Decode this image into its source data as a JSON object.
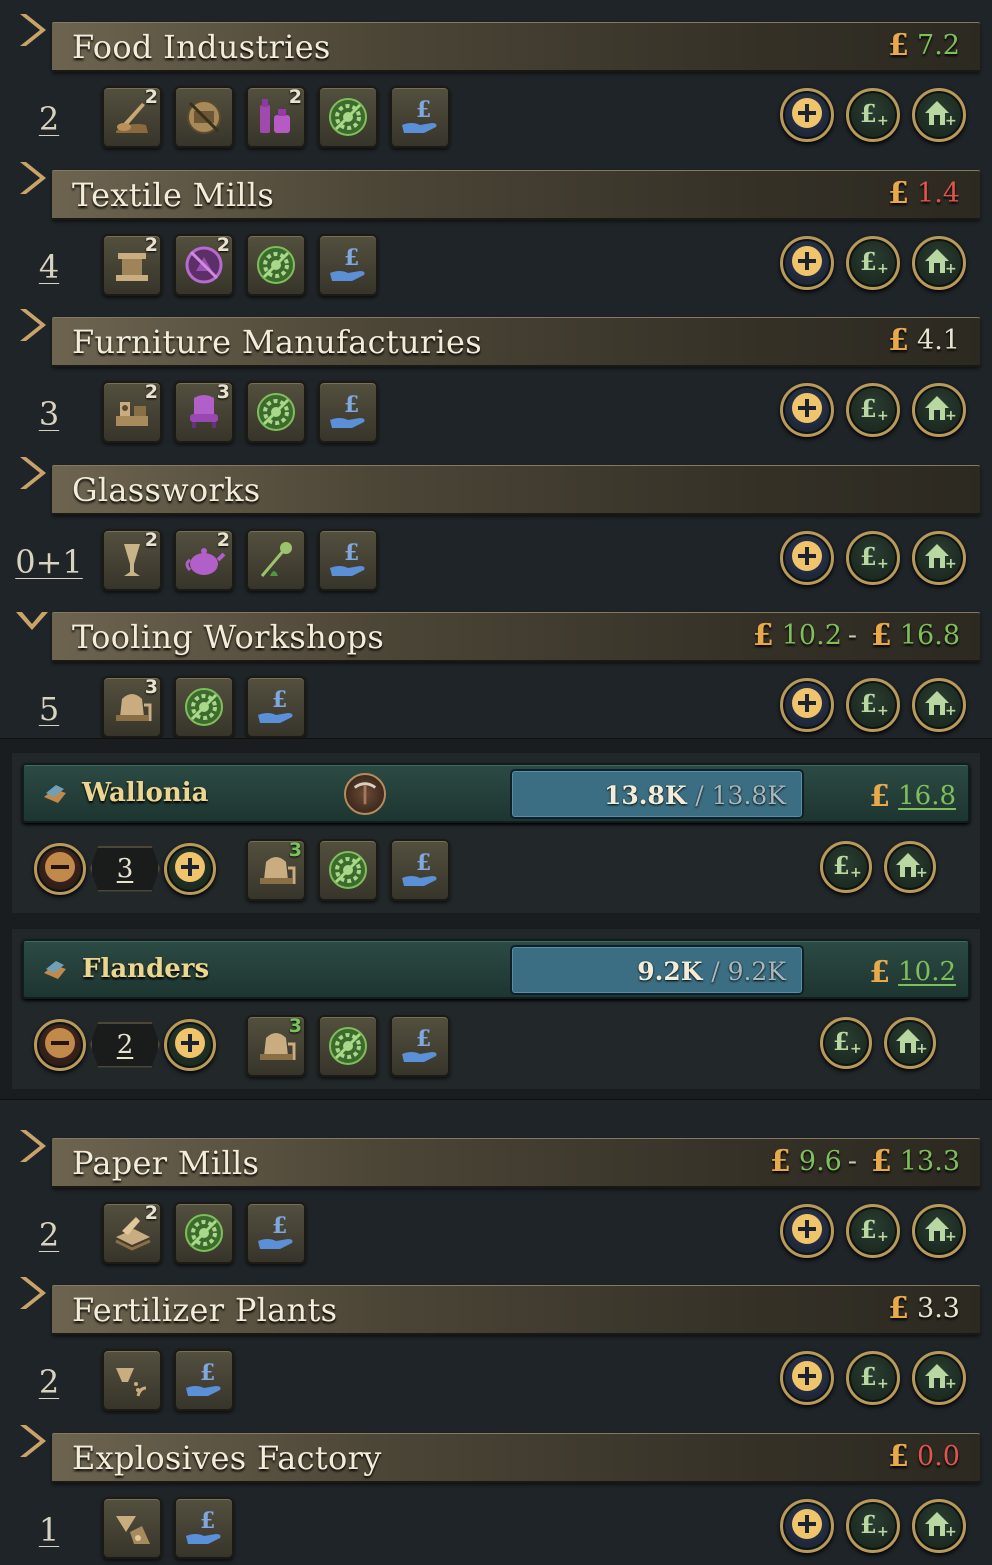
{
  "groups": [
    {
      "id": "food",
      "title": "Food Industries",
      "count": "2",
      "expanded": false,
      "money": [
        {
          "value": "7.2",
          "tone": "pos"
        }
      ],
      "tiles": [
        {
          "icon": "grain-scoop-icon",
          "badge": "2"
        },
        {
          "icon": "canned-goods-icon",
          "badge": ""
        },
        {
          "icon": "liquor-bottles-icon",
          "badge": "2"
        },
        {
          "icon": "production-method-gear-icon",
          "badge": ""
        },
        {
          "icon": "ownership-hand-pound-icon",
          "badge": ""
        }
      ]
    },
    {
      "id": "textile",
      "title": "Textile Mills",
      "count": "4",
      "expanded": false,
      "money": [
        {
          "value": "1.4",
          "tone": "neg"
        }
      ],
      "tiles": [
        {
          "icon": "loom-icon",
          "badge": "2"
        },
        {
          "icon": "no-luxury-clothes-icon",
          "badge": "2"
        },
        {
          "icon": "production-method-gear-icon",
          "badge": ""
        },
        {
          "icon": "ownership-hand-pound-icon",
          "badge": ""
        }
      ]
    },
    {
      "id": "furniture",
      "title": "Furniture Manufacturies",
      "count": "3",
      "expanded": false,
      "money": [
        {
          "value": "4.1",
          "tone": "neu"
        }
      ],
      "tiles": [
        {
          "icon": "lathe-icon",
          "badge": "2"
        },
        {
          "icon": "luxury-armchair-icon",
          "badge": "3"
        },
        {
          "icon": "production-method-gear-icon",
          "badge": ""
        },
        {
          "icon": "ownership-hand-pound-icon",
          "badge": ""
        }
      ]
    },
    {
      "id": "glass",
      "title": "Glassworks",
      "count": "0+1",
      "expanded": false,
      "money": [],
      "tiles": [
        {
          "icon": "glass-vase-icon",
          "badge": "2"
        },
        {
          "icon": "porcelain-teapot-icon",
          "badge": "2"
        },
        {
          "icon": "glassblowing-icon",
          "badge": ""
        },
        {
          "icon": "ownership-hand-pound-icon",
          "badge": ""
        }
      ]
    },
    {
      "id": "tooling",
      "title": "Tooling Workshops",
      "count": "5",
      "expanded": true,
      "money": [
        {
          "value": "10.2",
          "tone": "pos"
        },
        {
          "value": "16.8",
          "tone": "pos"
        }
      ],
      "tiles": [
        {
          "icon": "crucible-steel-icon",
          "badge": "3"
        },
        {
          "icon": "production-method-gear-icon",
          "badge": ""
        },
        {
          "icon": "ownership-hand-pound-icon",
          "badge": ""
        }
      ]
    },
    {
      "id": "paper",
      "title": "Paper Mills",
      "count": "2",
      "expanded": false,
      "money": [
        {
          "value": "9.6",
          "tone": "pos"
        },
        {
          "value": "13.3",
          "tone": "pos"
        }
      ],
      "tiles": [
        {
          "icon": "paper-stack-icon",
          "badge": "2"
        },
        {
          "icon": "production-method-gear-icon",
          "badge": ""
        },
        {
          "icon": "ownership-hand-pound-icon",
          "badge": ""
        }
      ]
    },
    {
      "id": "fertilizer",
      "title": "Fertilizer Plants",
      "count": "2",
      "expanded": false,
      "money": [
        {
          "value": "3.3",
          "tone": "neu"
        }
      ],
      "tiles": [
        {
          "icon": "fertilizer-pour-icon",
          "badge": ""
        },
        {
          "icon": "ownership-hand-pound-icon",
          "badge": ""
        }
      ]
    },
    {
      "id": "explosives",
      "title": "Explosives Factory",
      "count": "1",
      "expanded": false,
      "money": [
        {
          "value": "0.0",
          "tone": "neg"
        }
      ],
      "tiles": [
        {
          "icon": "chemical-flask-icon",
          "badge": ""
        },
        {
          "icon": "ownership-hand-pound-icon",
          "badge": ""
        }
      ]
    }
  ],
  "currency_symbol": "£",
  "range_separator": "-",
  "states": [
    {
      "name": "Wallonia",
      "employment": "13.8K",
      "employment_max": "13.8K",
      "fill_fraction": 1.0,
      "money": "16.8",
      "levels": "3",
      "has_resource_icon": true,
      "tiles": [
        {
          "icon": "crucible-steel-icon",
          "badge": "3"
        },
        {
          "icon": "production-method-gear-icon",
          "badge": ""
        },
        {
          "icon": "ownership-hand-pound-icon",
          "badge": ""
        }
      ]
    },
    {
      "name": "Flanders",
      "employment": "9.2K",
      "employment_max": "9.2K",
      "fill_fraction": 1.0,
      "money": "10.2",
      "levels": "2",
      "has_resource_icon": false,
      "tiles": [
        {
          "icon": "crucible-steel-icon",
          "badge": "3"
        },
        {
          "icon": "production-method-gear-icon",
          "badge": ""
        },
        {
          "icon": "ownership-hand-pound-icon",
          "badge": ""
        }
      ]
    }
  ],
  "colors": {
    "positive": "#7fbf5a",
    "negative": "#e1544c",
    "gold": "#e8a94a",
    "state_name": "#ecd68f"
  }
}
